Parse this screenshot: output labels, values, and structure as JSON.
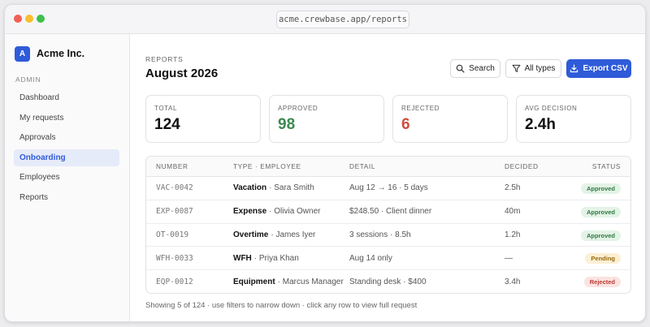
{
  "browser": {
    "url": "acme.crewbase.app/reports"
  },
  "sidebar": {
    "brand_initial": "A",
    "brand_name": "Acme Inc.",
    "section_label": "ADMIN",
    "items": [
      {
        "label": "Dashboard",
        "active": false
      },
      {
        "label": "My requests",
        "active": false
      },
      {
        "label": "Approvals",
        "active": false
      },
      {
        "label": "Onboarding",
        "active": true
      },
      {
        "label": "Employees",
        "active": false
      },
      {
        "label": "Reports",
        "active": false
      }
    ]
  },
  "header": {
    "eyebrow": "REPORTS",
    "title": "August 2026",
    "search_label": "Search",
    "filter_label": "All types",
    "export_label": "Export CSV"
  },
  "stats": [
    {
      "label": "TOTAL",
      "value": "124"
    },
    {
      "label": "APPROVED",
      "value": "98"
    },
    {
      "label": "REJECTED",
      "value": "6"
    },
    {
      "label": "AVG DECISION",
      "value": "2.4h"
    }
  ],
  "table": {
    "columns": [
      "NUMBER",
      "TYPE · EMPLOYEE",
      "DETAIL",
      "DECIDED",
      "STATUS"
    ],
    "rows": [
      {
        "number": "VAC-0042",
        "type": "Vacation",
        "employee": "· Sara Smith",
        "detail": "Aug 12 → 16 · 5 days",
        "decided": "2.5h",
        "status": "Approved"
      },
      {
        "number": "EXP-0087",
        "type": "Expense",
        "employee": "· Olivia Owner",
        "detail": "$248.50 · Client dinner",
        "decided": "40m",
        "status": "Approved"
      },
      {
        "number": "OT-0019",
        "type": "Overtime",
        "employee": "· James Iyer",
        "detail": "3 sessions · 8.5h",
        "decided": "1.2h",
        "status": "Approved"
      },
      {
        "number": "WFH-0033",
        "type": "WFH",
        "employee": "· Priya Khan",
        "detail": "Aug 14 only",
        "decided": "—",
        "status": "Pending"
      },
      {
        "number": "EQP-0012",
        "type": "Equipment",
        "employee": "· Marcus Manager",
        "detail": "Standing desk · $400",
        "decided": "3.4h",
        "status": "Rejected"
      }
    ]
  },
  "footer": {
    "note": "Showing 5 of 124 · use filters to narrow down · click any row to view full request"
  },
  "colors": {
    "accent": "#2f5bd9",
    "approved": "#3b8a4f",
    "rejected": "#d24b3f",
    "pending": "#9a6a0e"
  }
}
